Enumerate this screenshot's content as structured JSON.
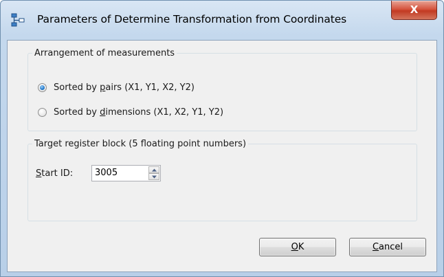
{
  "window": {
    "title": "Parameters of Determine Transformation from Coordinates",
    "close_label": "X"
  },
  "arrangement_group": {
    "legend": "Arrangement of measurements",
    "options": [
      {
        "label_before": "Sorted by ",
        "label_mnemonic": "p",
        "label_after": "airs (X1, Y1, X2, Y2)",
        "checked": true
      },
      {
        "label_before": "Sorted by ",
        "label_mnemonic": "d",
        "label_after": "imensions (X1, X2, Y1, Y2)",
        "checked": false
      }
    ]
  },
  "target_group": {
    "legend": "Target register block (5 floating point numbers)",
    "start_id_label_mnemonic": "S",
    "start_id_label_rest": "tart ID:",
    "start_id_value": "3005"
  },
  "buttons": {
    "ok_mnemonic": "O",
    "ok_rest": "K",
    "cancel_mnemonic": "C",
    "cancel_rest": "ancel"
  },
  "icons": {
    "app": "tree-structure-icon",
    "close": "close-icon",
    "spin_up": "chevron-up-icon",
    "spin_down": "chevron-down-icon"
  },
  "colors": {
    "title_bar": "#c4d8ed",
    "close_button": "#c9442c",
    "radio_selected": "#2a7fcf",
    "dialog_background": "#f0f0f0"
  }
}
